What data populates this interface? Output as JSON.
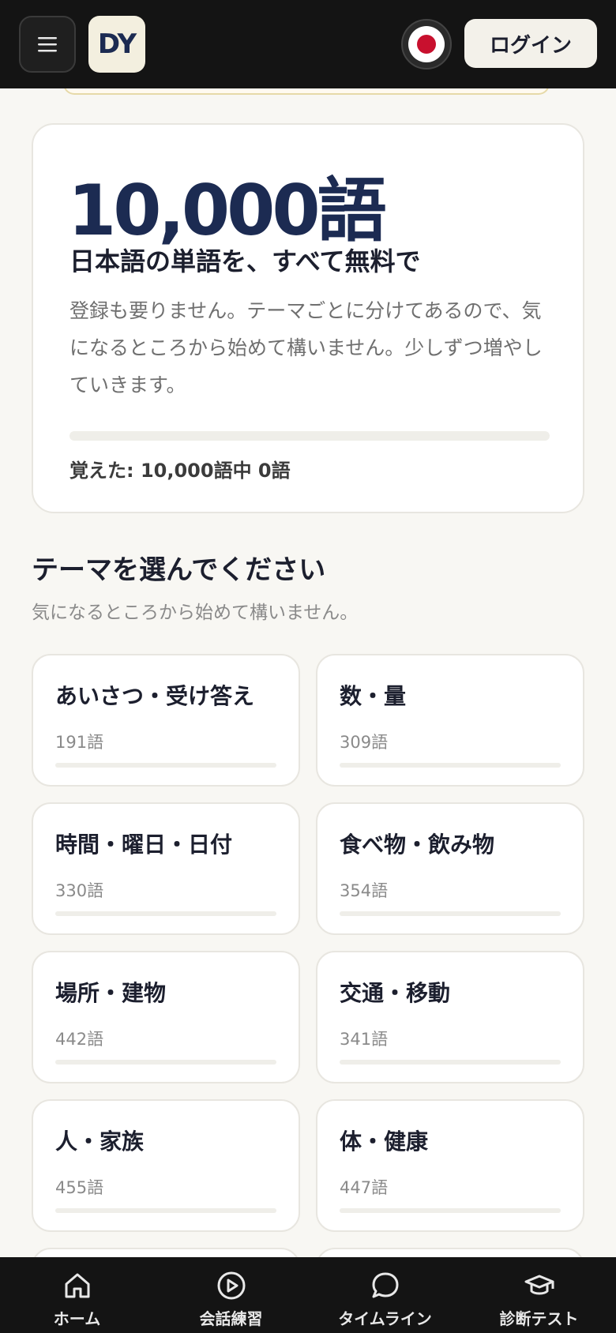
{
  "header": {
    "menu_icon": "hamburger-menu-icon",
    "logo_text": "DY",
    "language_flag": "japan-flag-icon",
    "login_label": "ログイン"
  },
  "hero": {
    "number": "10,000語",
    "subtitle": "日本語の単語を、すべて無料で",
    "description": "登録も要りません。テーマごとに分けてあるので、気になるところから始めて構いません。少しずつ増やしていきます。",
    "progress_fraction": 0,
    "progress_text": "覚えた: 10,000語中 0語"
  },
  "themes_section": {
    "title": "テーマを選んでください",
    "subtitle": "気になるところから始めて構いません。"
  },
  "themes": [
    {
      "title": "あいさつ・受け答え",
      "count": "191語",
      "progress": 0
    },
    {
      "title": "数・量",
      "count": "309語",
      "progress": 0
    },
    {
      "title": "時間・曜日・日付",
      "count": "330語",
      "progress": 0
    },
    {
      "title": "食べ物・飲み物",
      "count": "354語",
      "progress": 0
    },
    {
      "title": "場所・建物",
      "count": "442語",
      "progress": 0
    },
    {
      "title": "交通・移動",
      "count": "341語",
      "progress": 0
    },
    {
      "title": "人・家族",
      "count": "455語",
      "progress": 0
    },
    {
      "title": "体・健康",
      "count": "447語",
      "progress": 0
    }
  ],
  "bottom_nav": [
    {
      "label": "ホーム",
      "icon": "home-icon"
    },
    {
      "label": "会話練習",
      "icon": "play-circle-icon"
    },
    {
      "label": "タイムライン",
      "icon": "chat-bubble-icon"
    },
    {
      "label": "診断テスト",
      "icon": "graduation-cap-icon"
    }
  ],
  "colors": {
    "accent": "#1c2b52",
    "header_bg": "#141414",
    "page_bg": "#f8f7f3",
    "flag_red": "#c8102e"
  }
}
